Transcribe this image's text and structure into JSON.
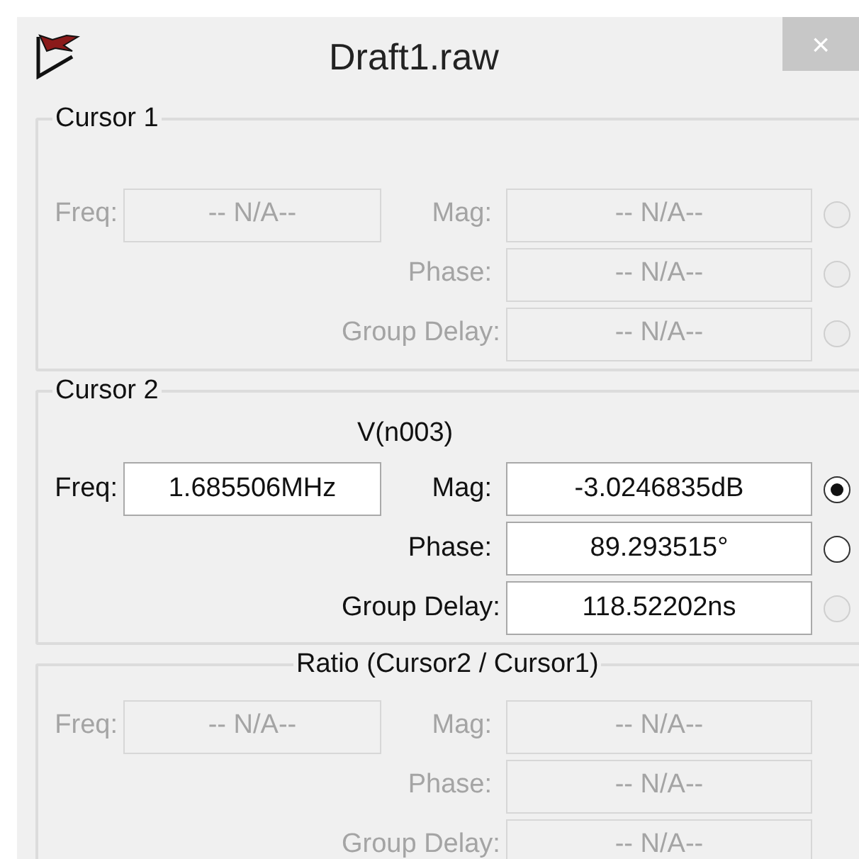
{
  "window": {
    "title": "Draft1.raw",
    "close": "×"
  },
  "sections": [
    {
      "title": "Cursor 1",
      "kind": "cursor",
      "disabled": true,
      "freq": {
        "label": "Freq:",
        "value": "-- N/A--"
      },
      "rows": [
        {
          "label": "Mag:",
          "value": "-- N/A--",
          "radio": {
            "selected": false,
            "disabled": true
          }
        },
        {
          "label": "Phase:",
          "value": "-- N/A--",
          "radio": {
            "selected": false,
            "disabled": true
          }
        },
        {
          "label": "Group Delay:",
          "value": "-- N/A--",
          "radio": {
            "selected": false,
            "disabled": true
          }
        }
      ]
    },
    {
      "title": "Cursor 2",
      "kind": "cursor",
      "disabled": false,
      "signal": "V(n003)",
      "freq": {
        "label": "Freq:",
        "value": "1.685506MHz"
      },
      "rows": [
        {
          "label": "Mag:",
          "value": "-3.0246835dB",
          "radio": {
            "selected": true,
            "disabled": false
          }
        },
        {
          "label": "Phase:",
          "value": "89.293515°",
          "radio": {
            "selected": false,
            "disabled": false
          }
        },
        {
          "label": "Group Delay:",
          "value": "118.52202ns",
          "radio": {
            "selected": false,
            "disabled": true
          }
        }
      ]
    },
    {
      "title": "Ratio (Cursor2 / Cursor1)",
      "kind": "ratio",
      "disabled": true,
      "freq": {
        "label": "Freq:",
        "value": "-- N/A--"
      },
      "rows": [
        {
          "label": "Mag:",
          "value": "-- N/A--"
        },
        {
          "label": "Phase:",
          "value": "-- N/A--"
        },
        {
          "label": "Group Delay:",
          "value": "-- N/A--"
        }
      ]
    }
  ]
}
